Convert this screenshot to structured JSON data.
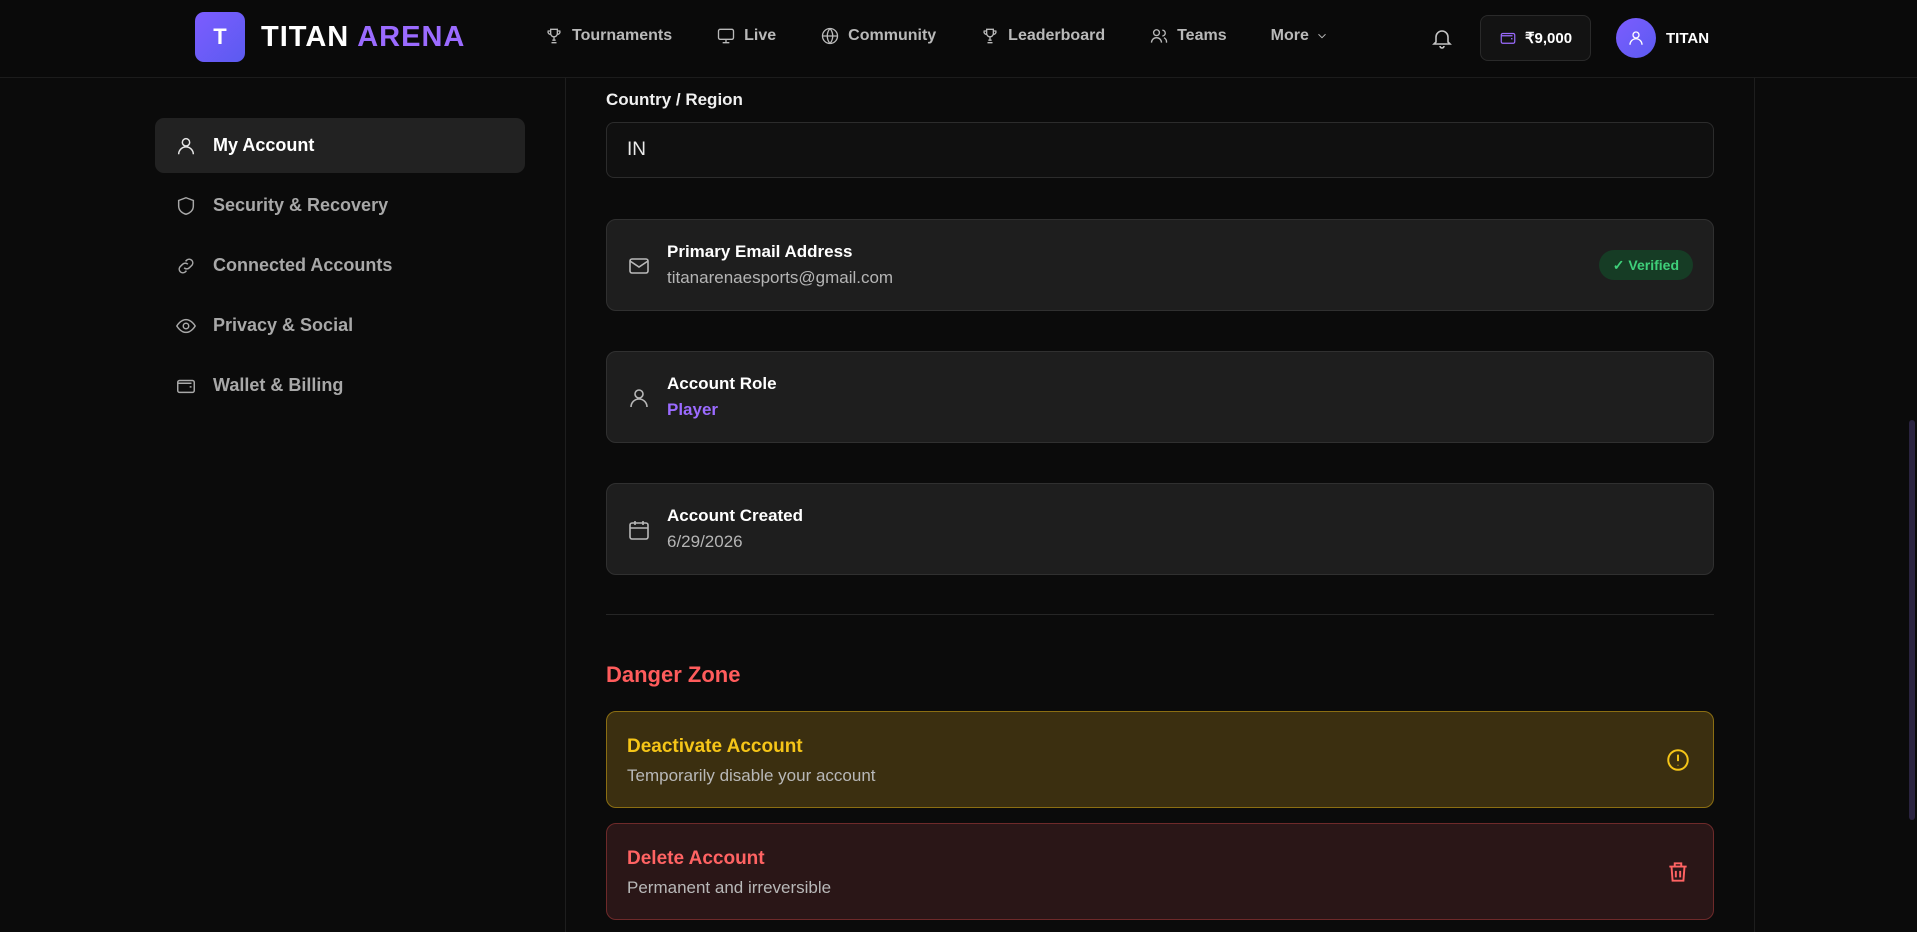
{
  "brand": {
    "badge": "T",
    "name_part1": "TITAN",
    "name_part2": "ARENA"
  },
  "nav": [
    {
      "label": "Tournaments",
      "icon": "trophy-icon"
    },
    {
      "label": "Live",
      "icon": "monitor-icon"
    },
    {
      "label": "Community",
      "icon": "globe-icon"
    },
    {
      "label": "Leaderboard",
      "icon": "trophy-icon"
    },
    {
      "label": "Teams",
      "icon": "users-icon"
    },
    {
      "label": "More",
      "icon": "chevron-down-icon"
    }
  ],
  "wallet": {
    "balance": "₹9,000"
  },
  "user": {
    "name": "TITAN"
  },
  "sidebar": {
    "items": [
      {
        "label": "My Account",
        "icon": "user-icon",
        "active": true
      },
      {
        "label": "Security & Recovery",
        "icon": "shield-icon"
      },
      {
        "label": "Connected Accounts",
        "icon": "link-icon"
      },
      {
        "label": "Privacy & Social",
        "icon": "eye-icon"
      },
      {
        "label": "Wallet & Billing",
        "icon": "wallet-icon"
      }
    ]
  },
  "account": {
    "country_label": "Country / Region",
    "country_value": "IN",
    "email": {
      "title": "Primary Email Address",
      "value": "titanarenaesports@gmail.com",
      "badge": "✓ Verified"
    },
    "role": {
      "title": "Account Role",
      "value": "Player"
    },
    "created": {
      "title": "Account Created",
      "value": "6/29/2026"
    }
  },
  "danger": {
    "title": "Danger Zone",
    "deactivate": {
      "title": "Deactivate Account",
      "desc": "Temporarily disable your account"
    },
    "delete": {
      "title": "Delete Account",
      "desc": "Permanent and irreversible"
    }
  },
  "colors": {
    "accent": "#9b6bff",
    "danger": "#ff5c5c",
    "warning": "#f5c518",
    "success": "#3fd07a"
  }
}
